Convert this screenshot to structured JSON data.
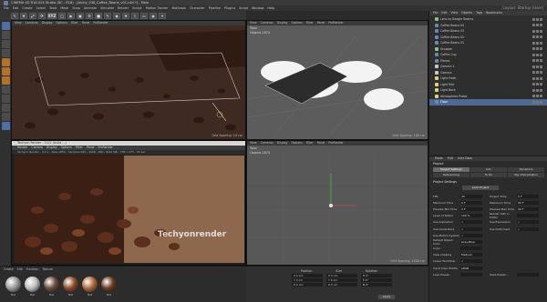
{
  "app": {
    "title": "CINEMA 4D R18.024 Studio (RC - R18) - [techy_036_Coffee_Beans_v01.c4d *] - Main",
    "layout_label": "Layout: Startup (User)"
  },
  "menu": [
    "File",
    "Edit",
    "Create",
    "Select",
    "Tools",
    "Mesh",
    "Snap",
    "Animate",
    "Simulate",
    "Render",
    "Sculpt",
    "Motion Tracker",
    "MoGraph",
    "Character",
    "Pipeline",
    "Plugins",
    "Script",
    "Window",
    "Help"
  ],
  "toolbar": {
    "xyz": "XYZ",
    "buttons": [
      "↖",
      "✥",
      "⤢",
      "⟳",
      "XYZ"
    ]
  },
  "viewport_menu": [
    "View",
    "Cameras",
    "Display",
    "Options",
    "Filter",
    "Panel",
    "ProRender"
  ],
  "viewports": {
    "top_left": {
      "label": "Perspective",
      "grid": "Grid Spacing: 10 cm"
    },
    "top_right": {
      "label": "Total",
      "objects": "Objects 1874",
      "grid": "Grid Spacing: 100 cm"
    },
    "bottom_right": {
      "label": "Total",
      "objects": "Objects 1874",
      "grid": "Grid Spacing: 1000 cm",
      "camera": "Front"
    }
  },
  "render_window": {
    "title": "Techyon Render - 3.0.1 (build ...)",
    "menu": [
      "Render",
      "Camera",
      "Display",
      "Options",
      "Filter",
      "Panel",
      "ProRender"
    ],
    "info": "Techyon Render - 3.0.1 - Pass 2850 - Samples 650 / 4096 - 890 / 8/40 MB - 785 x 275 - 30 sec",
    "watermark": "Techyonrender"
  },
  "materials": {
    "menu": [
      "Create",
      "Edit",
      "Function",
      "Texture"
    ],
    "items": [
      {
        "label": "Mat",
        "color": "#9a9a9a"
      },
      {
        "label": "Mat",
        "color": "#bdbdbd"
      },
      {
        "label": "Mat",
        "color": "#6b4a3a"
      },
      {
        "label": "Mat",
        "color": "#8a4a2a"
      },
      {
        "label": "Mat",
        "color": "#b06a3a"
      },
      {
        "label": "Mat",
        "color": "#6a3a22"
      }
    ]
  },
  "coordinates": {
    "headers": [
      "Position",
      "Size",
      "Rotation"
    ],
    "rows": [
      [
        "X  0 cm",
        "X  0 cm",
        "H  0°"
      ],
      [
        "Y  0 cm",
        "Y  0 cm",
        "P  0°"
      ],
      [
        "Z  0 cm",
        "Z  0 cm",
        "B  0°"
      ]
    ],
    "mode": "Object (Rel)",
    "apply": "Apply"
  },
  "object_manager": {
    "tabs": [
      "File",
      "Edit",
      "View",
      "Objects",
      "Tags",
      "Bookmarks"
    ],
    "items": [
      {
        "name": "Lens by Beagle Beams",
        "type": "null"
      },
      {
        "name": "Coffee Beans 04",
        "type": "obj"
      },
      {
        "name": "Coffee Beans 03",
        "type": "obj"
      },
      {
        "name": "Coffee Beans 02",
        "type": "obj"
      },
      {
        "name": "Coffee Beans 01",
        "type": "obj"
      },
      {
        "name": "Scooper",
        "type": "null"
      },
      {
        "name": "Coffee Cup",
        "type": "obj"
      },
      {
        "name": "Planes",
        "type": "obj"
      },
      {
        "name": "Camera 1",
        "type": "cam"
      },
      {
        "name": "Camera",
        "type": "cam"
      },
      {
        "name": "Light Fresh",
        "type": "light"
      },
      {
        "name": "Light Mid",
        "type": "light"
      },
      {
        "name": "Light Back",
        "type": "light"
      },
      {
        "name": "Atmosphere Probe",
        "type": "light"
      },
      {
        "name": "Floor",
        "type": "obj",
        "selected": true
      }
    ]
  },
  "attribute_manager": {
    "menu": [
      "Mode",
      "Edit",
      "User Data"
    ],
    "title": "Project",
    "tabs": [
      "Project Settings",
      "Info",
      "Dynamics",
      "Referencing",
      "To Do",
      "Key Interpolation"
    ],
    "section": "Project Settings",
    "button": "Load Project",
    "rows": [
      {
        "k": "FPS",
        "v": "30",
        "k2": "Project Time",
        "v2": "0 F"
      },
      {
        "k": "Minimum Time",
        "v": "0 F",
        "k2": "Maximum Time",
        "v2": "90 F"
      },
      {
        "k": "Preview Min Time",
        "v": "0 F",
        "k2": "Preview Max Time",
        "v2": "90 F"
      },
      {
        "k": "Level of Detail",
        "v": "100 %",
        "k2": "Render LOD in Editor",
        "v2": ""
      },
      {
        "k": "Use Animation",
        "v": "✓",
        "k2": "Use Expression",
        "v2": "✓"
      },
      {
        "k": "Use Generators",
        "v": "✓",
        "k2": "Use Deformers",
        "v2": "✓"
      },
      {
        "k": "Use Motion System",
        "v": "✓",
        "k2": "",
        "v2": ""
      },
      {
        "k": "Default Object Color",
        "v": "Gray-Blue",
        "k2": "",
        "v2": ""
      },
      {
        "k": "Color",
        "v": "",
        "k2": "",
        "v2": ""
      },
      {
        "k": "View Clipping",
        "v": "Medium",
        "k2": "",
        "v2": ""
      },
      {
        "k": "Linear Workflow",
        "v": "✓",
        "k2": "",
        "v2": ""
      },
      {
        "k": "Input Color Profile",
        "v": "sRGB",
        "k2": "",
        "v2": ""
      },
      {
        "k": "Load Preset...",
        "v": "",
        "k2": "Save Preset...",
        "v2": ""
      }
    ]
  }
}
